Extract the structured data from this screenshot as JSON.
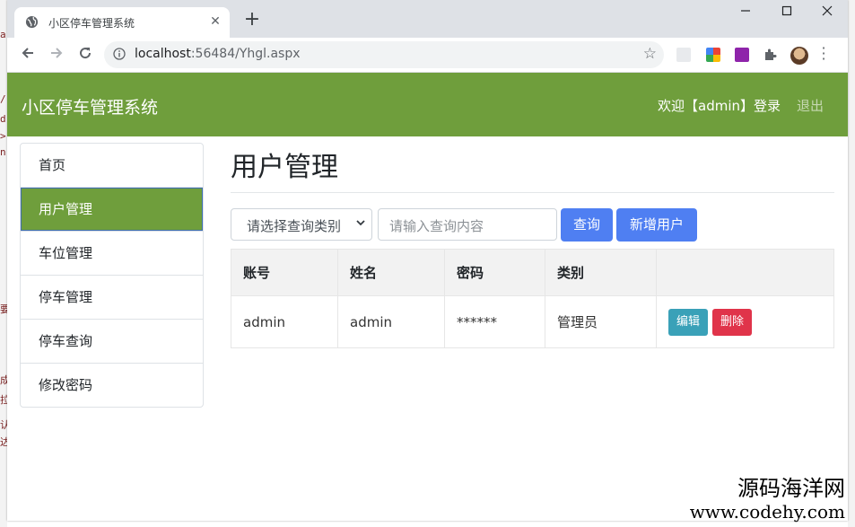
{
  "browser": {
    "tab_title": "小区停车管理系统",
    "tab_close": "✕",
    "new_tab": "+",
    "url_host": "localhost",
    "url_rest": ":56484/Yhgl.aspx"
  },
  "header": {
    "brand": "小区停车管理系统",
    "welcome": "欢迎【admin】登录",
    "logout": "退出"
  },
  "sidebar": {
    "items": [
      {
        "label": "首页"
      },
      {
        "label": "用户管理"
      },
      {
        "label": "车位管理"
      },
      {
        "label": "停车管理"
      },
      {
        "label": "停车查询"
      },
      {
        "label": "修改密码"
      }
    ],
    "active": "用户管理"
  },
  "main": {
    "title": "用户管理",
    "search": {
      "select_value": "请选择查询类别",
      "input_placeholder": "请输入查询内容",
      "query_label": "查询",
      "add_label": "新增用户"
    },
    "table": {
      "headers": [
        "账号",
        "姓名",
        "密码",
        "类别",
        ""
      ],
      "rows": [
        {
          "account": "admin",
          "name": "admin",
          "password": "******",
          "type": "管理员",
          "edit": "编辑",
          "delete": "删除"
        }
      ]
    }
  },
  "watermark": {
    "line1": "源码海洋网",
    "line2": "www.codehy.com"
  },
  "colors": {
    "navbar": "#6f9e3c",
    "primary_button": "#4f7ff2",
    "edit_button": "#3aa1b8",
    "delete_button": "#e0344a"
  }
}
